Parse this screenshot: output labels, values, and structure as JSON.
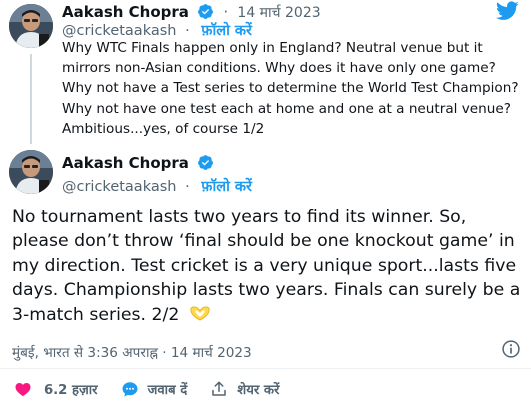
{
  "tweet1": {
    "author_name": "Aakash Chopra",
    "handle": "@cricketaakash",
    "follow_label": "फ़ॉलो करें",
    "date": "14 मार्च 2023",
    "separator": "·",
    "text": "Why WTC Finals happen only in England? Neutral venue but it mirrors non-Asian conditions. Why does it have only one game? Why not have a Test series to determine the World Test Champion? Why not have one test each at home and one at a neutral venue? Ambitious...yes, of course 1/2"
  },
  "tweet2": {
    "author_name": "Aakash Chopra",
    "handle": "@cricketaakash",
    "follow_label": "फ़ॉलो करें",
    "separator": "·",
    "text": "No tournament lasts two years to find its winner. So, please don’t throw ‘final should be one knockout game’ in my direction. Test cricket is a very unique sport...lasts five days. Championship lasts two years. Finals can surely be a 3-match series. 2/2",
    "timestamp": "मुंबई, भारत से 3:36 अपराह्न · 14 मार्च 2023"
  },
  "actions": {
    "likes": "6.2 हज़ार",
    "reply_label": "जवाब दें",
    "share_label": "शेयर करें"
  },
  "icons": {
    "platform": "twitter-bird-icon",
    "verified": "verified-badge-icon",
    "info": "info-icon",
    "like": "heart-icon",
    "reply": "reply-icon",
    "share": "share-icon",
    "emoji": "heart-hands-emoji"
  },
  "colors": {
    "accent": "#1d9bf0",
    "like": "#f91880",
    "secondary_text": "#536471",
    "emoji": "#ffd84d"
  }
}
